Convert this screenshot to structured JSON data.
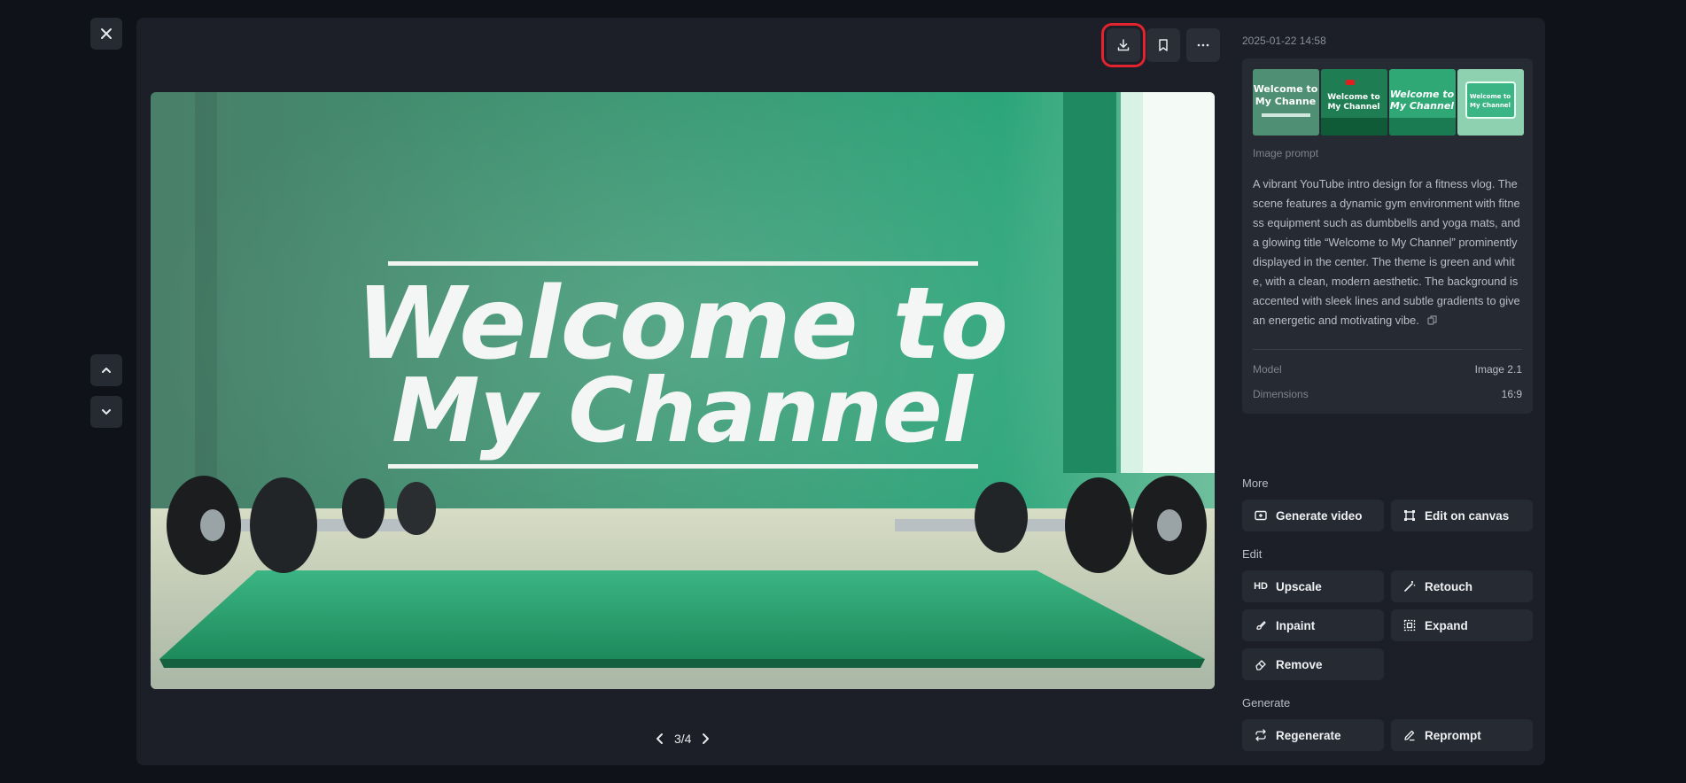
{
  "viewer": {
    "page_indicator": "3/4"
  },
  "image": {
    "headline_line1": "Welcome to",
    "headline_line2": "My Channel"
  },
  "thumbnails": [
    {
      "caption": "Welcome to My Channe"
    },
    {
      "caption": "Welcome to My Channel"
    },
    {
      "caption": "Welcome to My Channel"
    },
    {
      "caption": "Welcome to My Channel"
    }
  ],
  "info": {
    "date": "2025-01-22 14:58",
    "prompt_label": "Image prompt",
    "prompt_text": "A vibrant YouTube intro design for a fitness vlog. The scene features a dynamic gym environment with fitness equipment such as dumbbells and yoga mats, and a glowing title “Welcome to My Channel” prominently displayed in the center. The theme is green and white, with a clean, modern aesthetic. The background is accented with sleek lines and subtle gradients to give an energetic and motivating vibe.",
    "model_label": "Model",
    "model_value": "Image 2.1",
    "dimensions_label": "Dimensions",
    "dimensions_value": "16:9"
  },
  "sections": {
    "more": "More",
    "edit": "Edit",
    "generate": "Generate"
  },
  "actions": {
    "generate_video": "Generate video",
    "edit_on_canvas": "Edit on canvas",
    "upscale": "Upscale",
    "upscale_icon_text": "HD",
    "retouch": "Retouch",
    "inpaint": "Inpaint",
    "expand": "Expand",
    "remove": "Remove",
    "regenerate": "Regenerate",
    "reprompt": "Reprompt"
  },
  "colors": {
    "highlight": "#e3232d",
    "accent_green": "#2e9a6c"
  }
}
